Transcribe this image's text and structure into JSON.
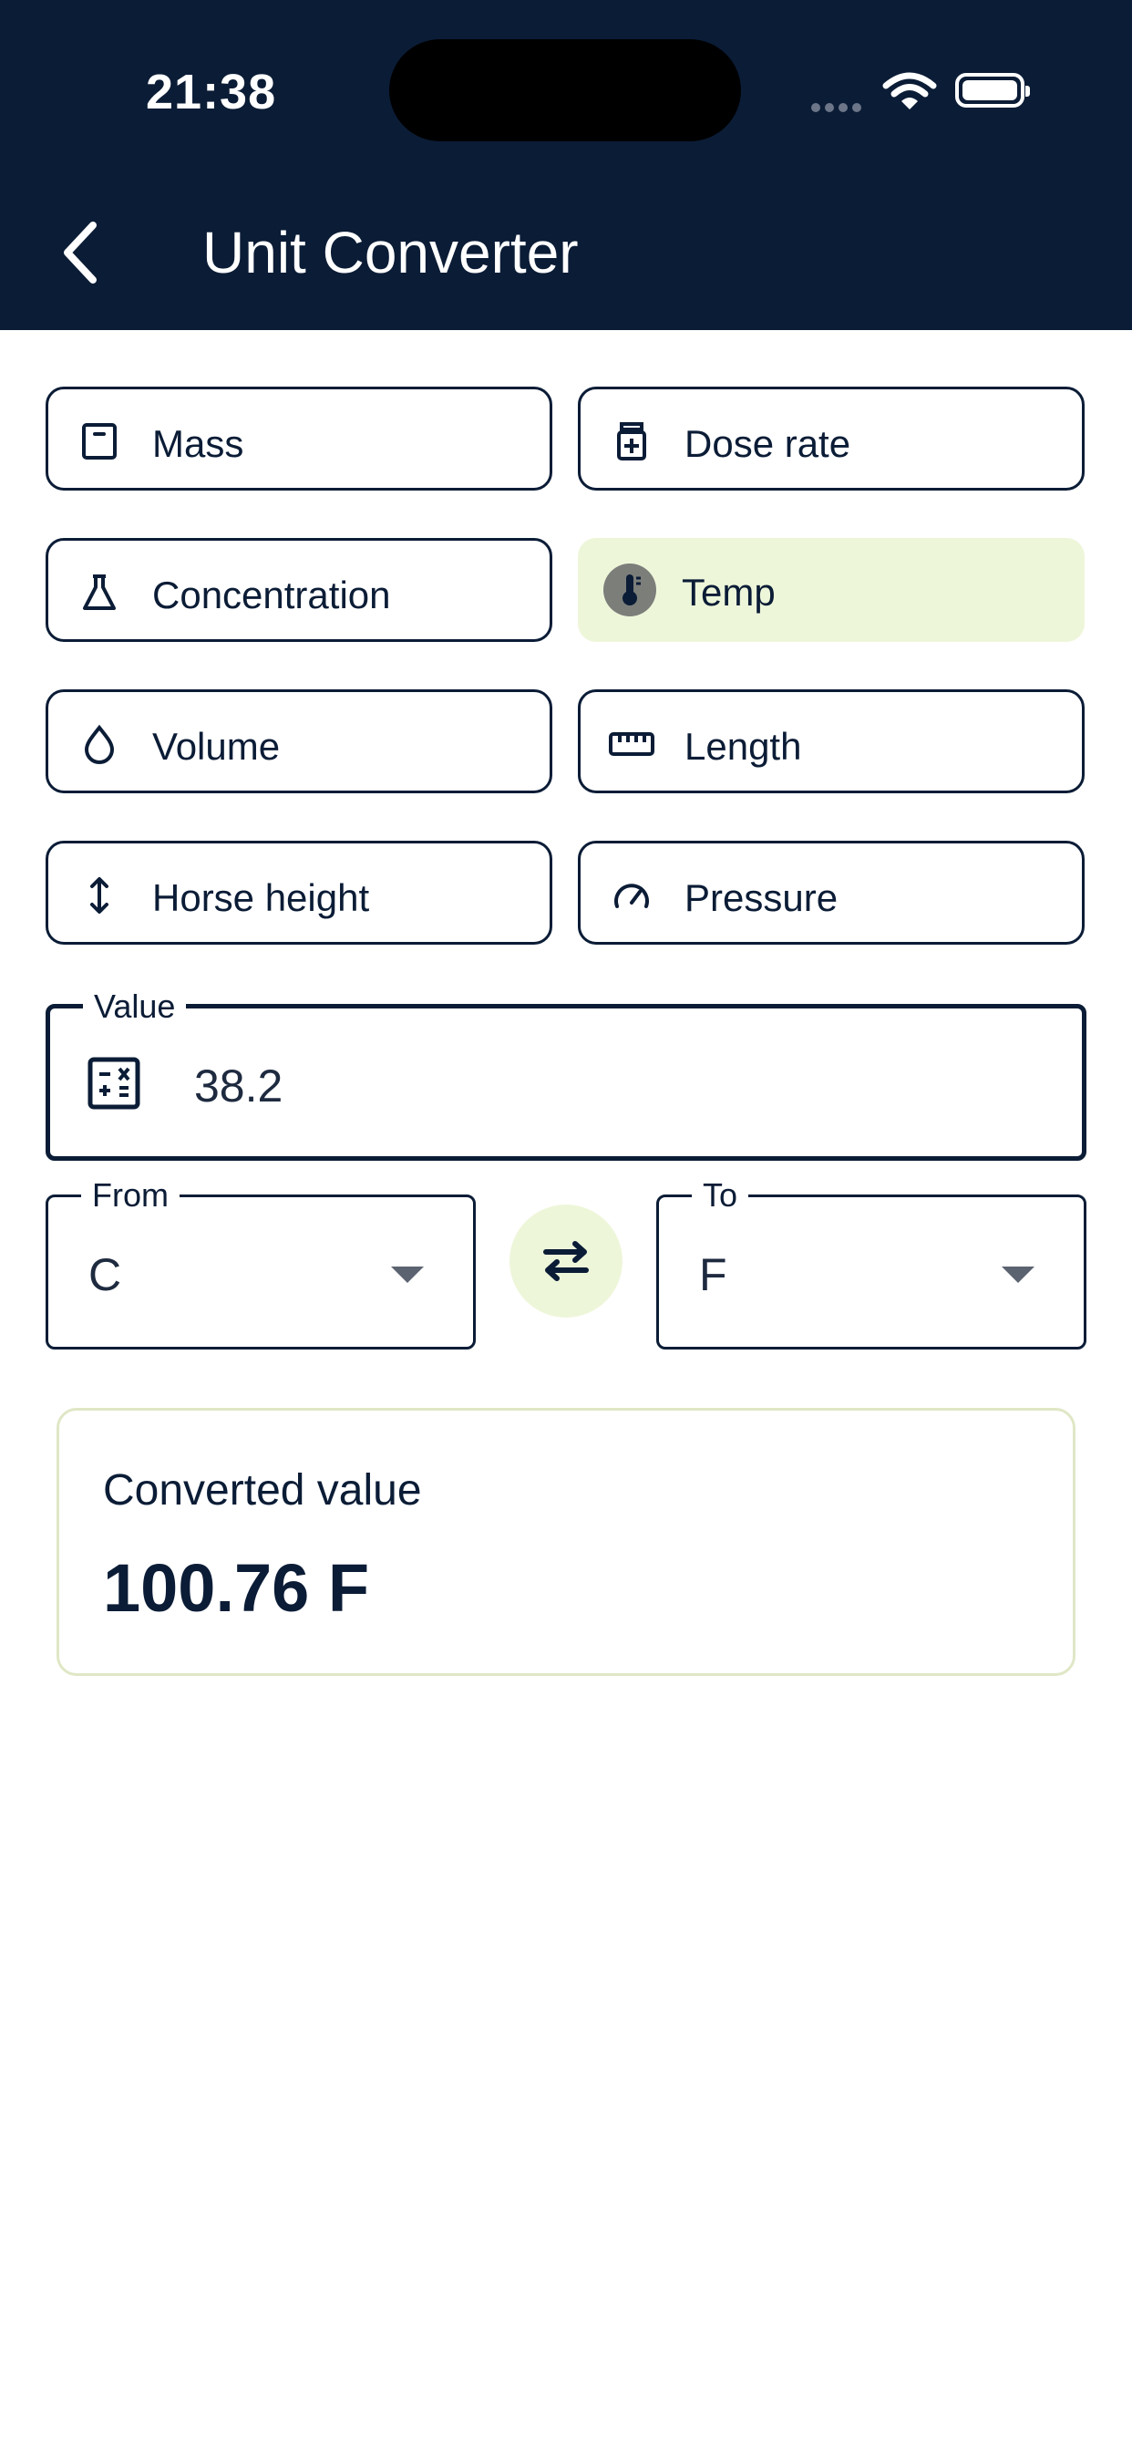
{
  "status_bar": {
    "time": "21:38"
  },
  "header": {
    "title": "Unit Converter"
  },
  "categories": [
    {
      "label": "Mass",
      "icon": "scale-icon",
      "active": false
    },
    {
      "label": "Dose rate",
      "icon": "medicine-bottle-icon",
      "active": false
    },
    {
      "label": "Concentration",
      "icon": "flask-icon",
      "active": false
    },
    {
      "label": "Temp",
      "icon": "thermometer-icon",
      "active": true
    },
    {
      "label": "Volume",
      "icon": "droplet-icon",
      "active": false
    },
    {
      "label": "Length",
      "icon": "ruler-icon",
      "active": false
    },
    {
      "label": "Horse height",
      "icon": "vertical-arrows-icon",
      "active": false
    },
    {
      "label": "Pressure",
      "icon": "gauge-icon",
      "active": false
    }
  ],
  "value_field": {
    "label": "Value",
    "value": "38.2"
  },
  "from_field": {
    "label": "From",
    "value": "C"
  },
  "to_field": {
    "label": "To",
    "value": "F"
  },
  "result": {
    "label": "Converted value",
    "value": "100.76 F"
  },
  "colors": {
    "header_bg": "#0b1c36",
    "active_chip_bg": "#eef6da",
    "text": "#0b1c36"
  }
}
